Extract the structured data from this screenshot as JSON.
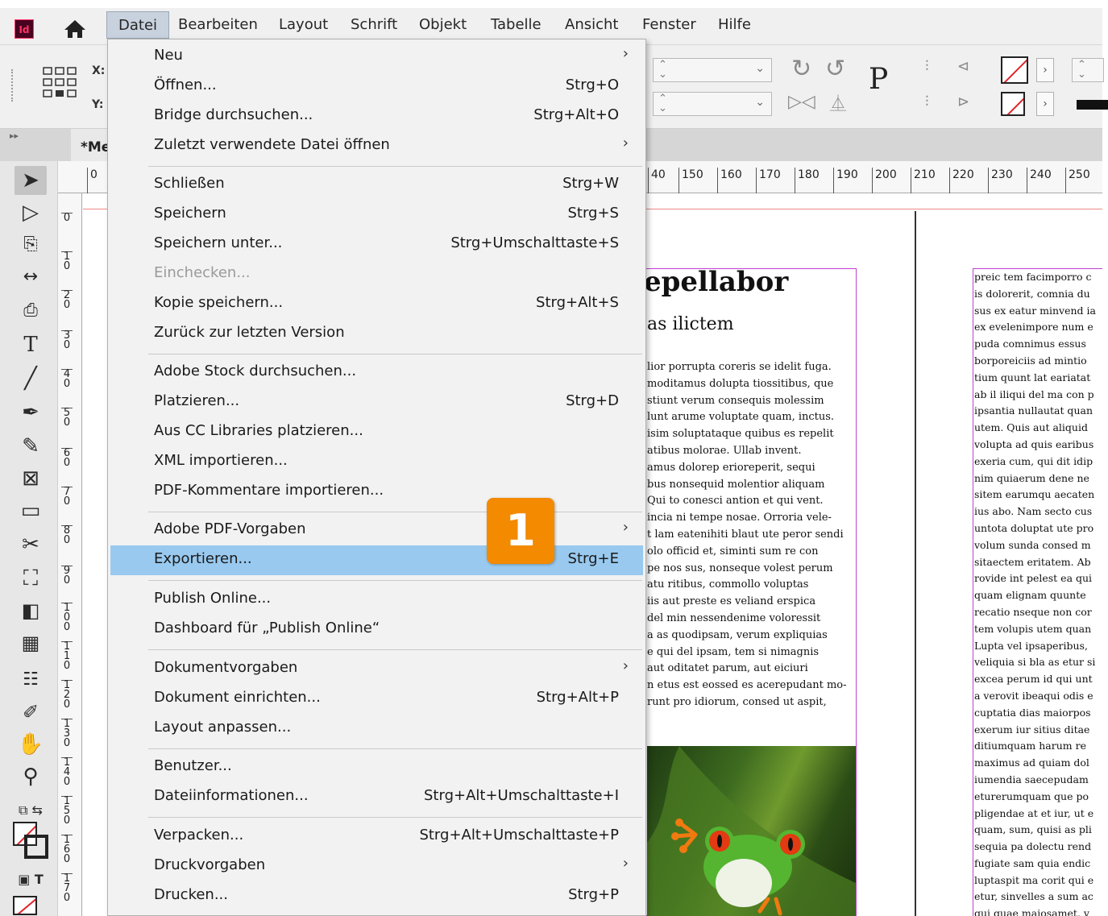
{
  "app": {
    "logo_text": "Id",
    "accent": "#ff3366",
    "badge_color": "#f38a00",
    "highlight_color": "#99c9ef"
  },
  "menubar": {
    "items": [
      "Datei",
      "Bearbeiten",
      "Layout",
      "Schrift",
      "Objekt",
      "Tabelle",
      "Ansicht",
      "Fenster",
      "Hilfe"
    ],
    "active": "Datei"
  },
  "control_panel": {
    "x_label": "X:",
    "y_label": "Y:"
  },
  "document": {
    "tab_label": "*Me"
  },
  "ruler": {
    "h_ticks": [
      "0",
      "40",
      "150",
      "160",
      "170",
      "180",
      "190",
      "200",
      "210",
      "220",
      "230",
      "240",
      "250"
    ],
    "v_ticks": [
      "0",
      "1\n0",
      "2\n0",
      "3\n0",
      "4\n0",
      "5\n0",
      "6\n0",
      "7\n0",
      "8\n0",
      "9\n0",
      "1\n0\n0",
      "1\n1\n0",
      "1\n2\n0",
      "1\n3\n0",
      "1\n4\n0",
      "1\n5\n0",
      "1\n6\n0",
      "1\n7\n0"
    ]
  },
  "file_menu": {
    "items": [
      {
        "label": "Neu",
        "shortcut": "",
        "submenu": true
      },
      {
        "label": "Öffnen...",
        "shortcut": "Strg+O"
      },
      {
        "label": "Bridge durchsuchen...",
        "shortcut": "Strg+Alt+O"
      },
      {
        "label": "Zuletzt verwendete Datei öffnen",
        "shortcut": "",
        "submenu": true
      },
      {
        "label": "Schließen",
        "shortcut": "Strg+W"
      },
      {
        "label": "Speichern",
        "shortcut": "Strg+S"
      },
      {
        "label": "Speichern unter...",
        "shortcut": "Strg+Umschalttaste+S"
      },
      {
        "label": "Einchecken...",
        "shortcut": "",
        "disabled": true
      },
      {
        "label": "Kopie speichern...",
        "shortcut": "Strg+Alt+S"
      },
      {
        "label": "Zurück zur letzten Version",
        "shortcut": ""
      },
      {
        "label": "Adobe Stock durchsuchen...",
        "shortcut": ""
      },
      {
        "label": "Platzieren...",
        "shortcut": "Strg+D"
      },
      {
        "label": "Aus CC Libraries platzieren...",
        "shortcut": ""
      },
      {
        "label": "XML importieren...",
        "shortcut": ""
      },
      {
        "label": "PDF-Kommentare importieren...",
        "shortcut": ""
      },
      {
        "label": "Adobe PDF-Vorgaben",
        "shortcut": "",
        "submenu": true
      },
      {
        "label": "Exportieren...",
        "shortcut": "Strg+E",
        "highlighted": true
      },
      {
        "label": "Publish Online...",
        "shortcut": ""
      },
      {
        "label": "Dashboard für „Publish Online“",
        "shortcut": ""
      },
      {
        "label": "Dokumentvorgaben",
        "shortcut": "",
        "submenu": true
      },
      {
        "label": "Dokument einrichten...",
        "shortcut": "Strg+Alt+P"
      },
      {
        "label": "Layout anpassen...",
        "shortcut": ""
      },
      {
        "label": "Benutzer...",
        "shortcut": ""
      },
      {
        "label": "Dateiinformationen...",
        "shortcut": "Strg+Alt+Umschalttaste+I"
      },
      {
        "label": "Verpacken...",
        "shortcut": "Strg+Alt+Umschalttaste+P"
      },
      {
        "label": "Druckvorgaben",
        "shortcut": "",
        "submenu": true
      },
      {
        "label": "Drucken...",
        "shortcut": "Strg+P"
      }
    ]
  },
  "callout": {
    "number": "1"
  },
  "page": {
    "heading1": "epellabor",
    "heading2": "as ilictem",
    "left_text": "lior porrupta coreris se idelit fuga.\nmoditamus dolupta tiossitibus, que\nstiunt verum consequis molessim\nlunt arume voluptate quam, inctus.\nisim soluptataque quibus es repelit\natibus molorae. Ullab invent.\namus dolorep erioreperit, sequi\nbus nonsequid molentior aliquam\nQui to conesci antion et qui vent.\nincia ni tempe nosae. Orroria vele-\nt lam eatenihiti blaut ute peror sendi\nolo officid et, siminti sum re con\npe nos sus, nonseque volest perum\natu ritibus, commollo voluptas\niis aut preste es veliand erspica\ndel min nessendenime voloressit\na as quodipsam, verum expliquias\ne qui del ipsam, tem si nimagnis\naut oditatet parum, aut eiciuri\nn etus est eossed es acerepudant mo-\nrunt pro idiorum, consed ut aspit,",
    "right_text": "preic tem facimporro c\nis dolorerit, comnia du\nsus ex eatur minvend ia\nex evelenimpore num e\npuda comnimus essus\nborporeiciis ad mintio\ntium quunt lat eariatat\nab il iliqui del ma con p\nipsantia nullautat quan\nutem. Quis aut aliquid\nvolupta ad quis earibus\nexeria cum, qui dit idip\nnim quiaerum dene ne\nsitem earumqu aecaten\nius abo. Nam secto cus\nuntota doluptat ute pro\nvolum sunda consed m\nsitaectem eritatem. Ab\nrovide int pelest ea qui\nquam elignam quunte\nrecatio nseque non cor\ntem volupis utem quan\nLupta vel ipsaperibus,\nveliquia si bla as etur si\nexcea perum id qui unt\na verovit ibeaqui odis e\ncuptatia dias maiorpos\nexerum iur sitius ditae\nditiumquam harum re\nmaximus ad quiam dol\niumendia saecepudam\neturerumquam que po\npligendae at et iur, ut e\nquam, sum, quisi as pli\nsequia pa dolectu rend\nfugiate sam quia endic\nluptaspit ma corit qui e\netur, sinvelles a sum ac\nqui quae maiosamet, v"
  }
}
